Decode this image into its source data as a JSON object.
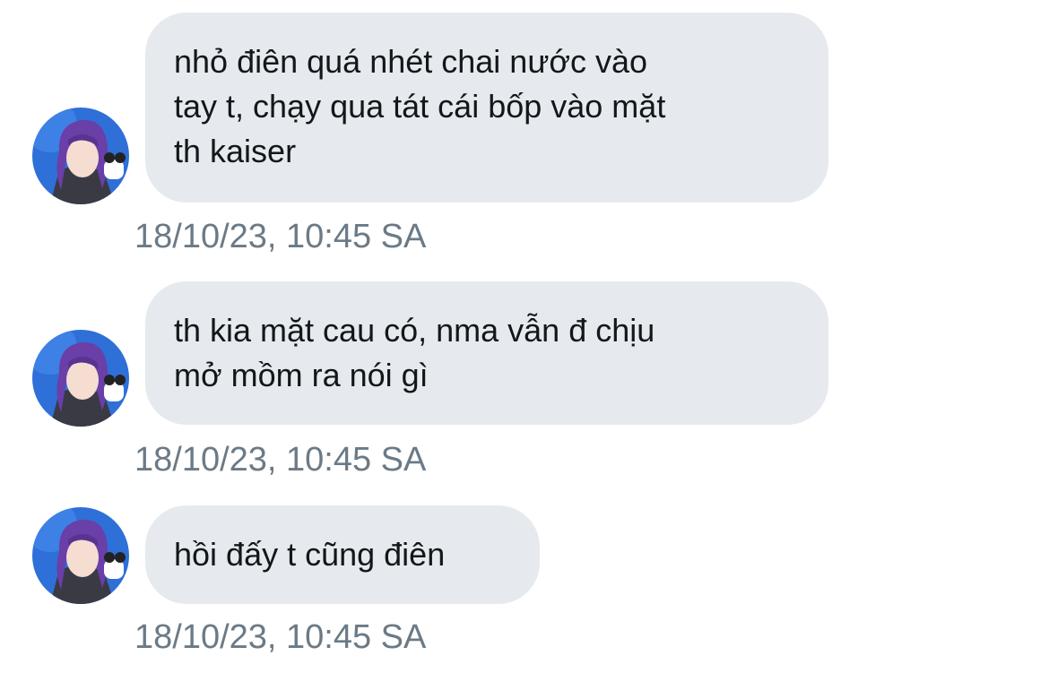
{
  "conversation": {
    "messages": [
      {
        "lines": [
          "nhỏ điên quá nhét chai nước vào",
          "tay t, chạy qua tát cái bốp vào mặt",
          "th kaiser"
        ],
        "timestamp": "18/10/23, 10:45 SA"
      },
      {
        "lines": [
          "th kia mặt cau có, nma vẫn đ chịu",
          "mở mồm ra nói gì"
        ],
        "timestamp": "18/10/23, 10:45 SA"
      },
      {
        "lines": [
          "hồi đấy t cũng điên"
        ],
        "timestamp": "18/10/23, 10:45 SA"
      }
    ],
    "avatar_icon": "user-avatar-anime-icon",
    "colors": {
      "bubble": "#e6eaee",
      "text": "#14171a",
      "timestamp": "#6b7a86",
      "avatar_bg": "#2f6fd8",
      "avatar_hair": "#6a3fa8"
    }
  }
}
